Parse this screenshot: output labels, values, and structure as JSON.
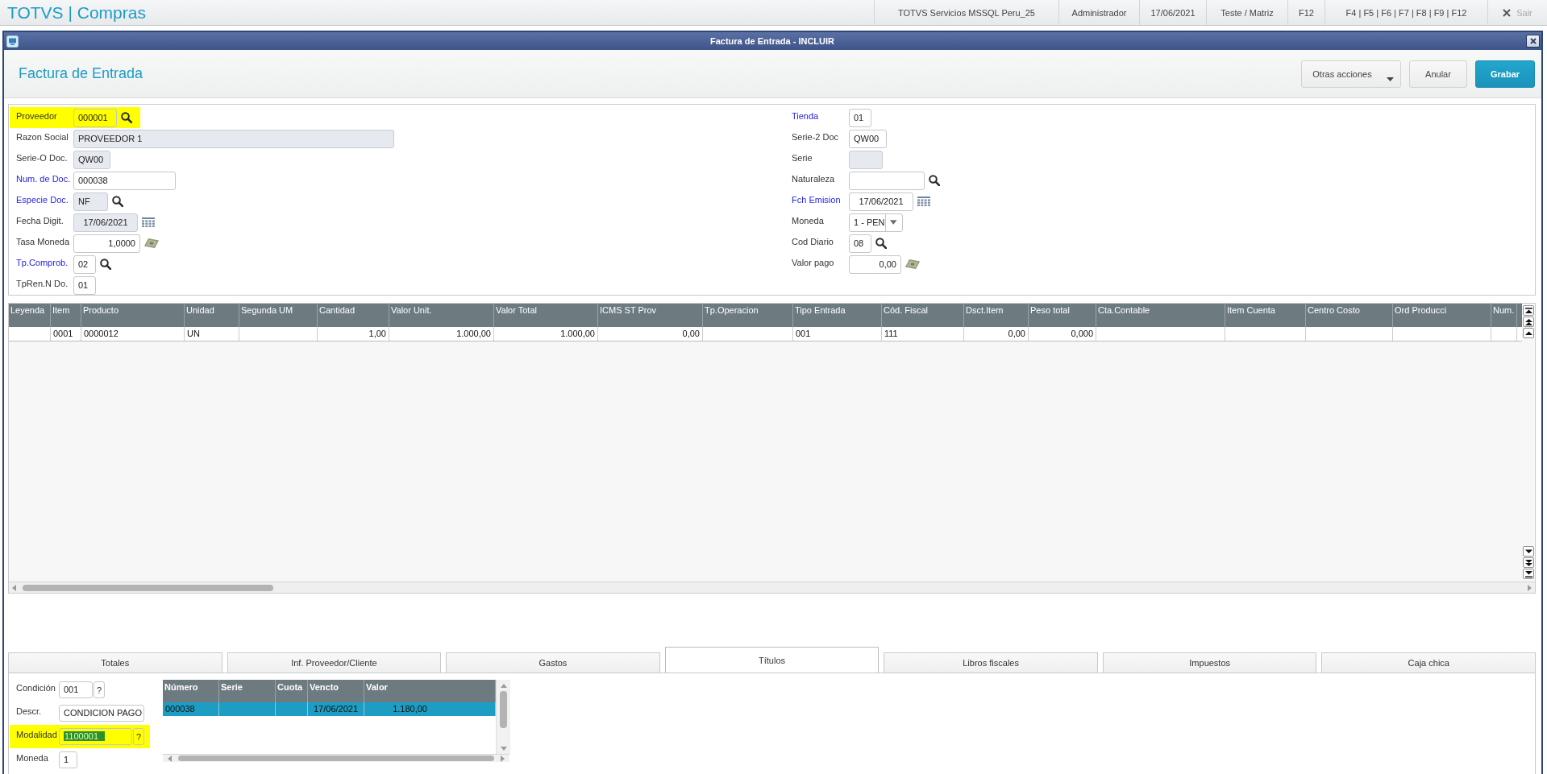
{
  "app_bar": {
    "title": "TOTVS | Compras",
    "info": [
      "TOTVS Servicios MSSQL Peru_25",
      "Administrador",
      "17/06/2021",
      "Teste / Matriz",
      "F12",
      "F4 | F5 | F6 | F7 | F8 | F9 | F12"
    ],
    "exit": {
      "label": "Sair",
      "disabled": true
    }
  },
  "window": {
    "title": "Factura de Entrada - INCLUIR"
  },
  "header": {
    "title": "Factura de Entrada",
    "actions": [
      {
        "label": "Otras acciones",
        "kind": "menu"
      },
      {
        "label": "Anular",
        "kind": "secondary"
      },
      {
        "label": "Grabar",
        "kind": "primary"
      }
    ]
  },
  "form": {
    "columns": [
      [
        {
          "label": "Proveedor",
          "value": "000001",
          "kind": "text",
          "required": false,
          "readonly": false,
          "highlighted": true,
          "addon": {
            "kind": "search"
          }
        },
        {
          "label": "Razon Social",
          "value": "PROVEEDOR 1",
          "kind": "text",
          "required": false,
          "readonly": true,
          "highlighted": false
        },
        {
          "label": "Serie-O Doc.",
          "value": "QW00",
          "kind": "text",
          "required": false,
          "readonly": true,
          "highlighted": false
        },
        {
          "label": "Num. de Doc.",
          "value": "000038",
          "kind": "text",
          "required": true,
          "readonly": false,
          "highlighted": false
        },
        {
          "label": "Especie Doc.",
          "value": "NF",
          "kind": "text",
          "required": true,
          "readonly": true,
          "highlighted": false,
          "addon": {
            "kind": "search"
          }
        },
        {
          "label": "Fecha Digit.",
          "value": "17/06/2021",
          "kind": "date",
          "required": false,
          "readonly": true,
          "highlighted": false,
          "addon": {
            "kind": "calendar"
          }
        },
        {
          "label": "Tasa Moneda",
          "value": "1,0000",
          "kind": "number",
          "required": false,
          "readonly": false,
          "highlighted": false,
          "addon": {
            "kind": "money"
          }
        },
        {
          "label": "Tp.Comprob.",
          "value": "02",
          "kind": "text",
          "required": true,
          "readonly": false,
          "highlighted": false,
          "addon": {
            "kind": "search"
          }
        },
        {
          "label": "TpRen.N Do.",
          "value": "01",
          "kind": "text",
          "required": false,
          "readonly": false,
          "highlighted": false
        }
      ],
      [
        {
          "label": "Tienda",
          "value": "01",
          "kind": "text",
          "required": true,
          "readonly": false,
          "highlighted": false
        },
        {
          "label": "Serie-2 Doc",
          "value": "QW00",
          "kind": "text",
          "required": false,
          "readonly": false,
          "highlighted": false
        },
        {
          "label": "Serie",
          "kind": "text",
          "required": false,
          "readonly": true,
          "highlighted": false
        },
        {
          "label": "Naturaleza",
          "kind": "text",
          "required": false,
          "readonly": false,
          "highlighted": false,
          "addon": {
            "kind": "search"
          }
        },
        {
          "label": "Fch Emision",
          "value": "17/06/2021",
          "kind": "date",
          "required": true,
          "readonly": false,
          "highlighted": false,
          "addon": {
            "kind": "calendar"
          }
        },
        {
          "label": "Moneda",
          "value": "1 - PEN",
          "kind": "select",
          "required": false,
          "readonly": false,
          "highlighted": false
        },
        {
          "label": "Cod Diario",
          "value": "08",
          "kind": "text",
          "required": false,
          "readonly": false,
          "highlighted": false,
          "addon": {
            "kind": "search"
          }
        },
        {
          "label": "Valor pago",
          "value": "0,00",
          "kind": "number",
          "required": false,
          "readonly": false,
          "highlighted": false,
          "addon": {
            "kind": "money"
          }
        }
      ]
    ]
  },
  "items_grid": {
    "columns": [
      {
        "label": "Leyenda",
        "kind": "text"
      },
      {
        "label": "Item",
        "kind": "text"
      },
      {
        "label": "Producto",
        "kind": "text"
      },
      {
        "label": "Unidad",
        "kind": "text"
      },
      {
        "label": "Segunda UM",
        "kind": "text"
      },
      {
        "label": "Cantidad",
        "kind": "number"
      },
      {
        "label": "Valor Unit.",
        "kind": "number"
      },
      {
        "label": "Valor Total",
        "kind": "number"
      },
      {
        "label": "ICMS ST Prov",
        "kind": "number"
      },
      {
        "label": "Tp.Operacion",
        "kind": "text"
      },
      {
        "label": "Tipo Entrada",
        "kind": "text"
      },
      {
        "label": "Cód. Fiscal",
        "kind": "text"
      },
      {
        "label": "Dsct.Item",
        "kind": "number"
      },
      {
        "label": "Peso total",
        "kind": "number"
      },
      {
        "label": "Cta.Contable",
        "kind": "text"
      },
      {
        "label": "Item Cuenta",
        "kind": "text"
      },
      {
        "label": "Centro Costo",
        "kind": "text"
      },
      {
        "label": "Ord Producci",
        "kind": "text"
      },
      {
        "label": "Num.",
        "kind": "text"
      }
    ],
    "rows": [
      {
        "cells": [
          null,
          "0001",
          "0000012",
          "UN",
          null,
          "1,00",
          "1.000,00",
          "1.000,00",
          "0,00",
          null,
          "001",
          "111",
          "0,00",
          "0,000",
          null,
          null,
          null,
          null,
          null
        ]
      }
    ]
  },
  "tabs": [
    {
      "label": "Totales",
      "selected": false
    },
    {
      "label": "Inf. Proveedor/Cliente",
      "selected": false
    },
    {
      "label": "Gastos",
      "selected": false
    },
    {
      "label": "Títulos",
      "selected": true
    },
    {
      "label": "Libros fiscales",
      "selected": false
    },
    {
      "label": "Impuestos",
      "selected": false
    },
    {
      "label": "Caja chica",
      "selected": false
    }
  ],
  "tab_panel": {
    "fields": [
      {
        "label": "Condición",
        "value": "001",
        "action": "?",
        "highlighted": false,
        "text_selected": false
      },
      {
        "label": "Descr.",
        "value": "CONDICION PAGO",
        "highlighted": false,
        "text_selected": false
      },
      {
        "label": "Modalidad",
        "value": "1100001",
        "action": "?",
        "highlighted": true,
        "text_selected": true
      },
      {
        "label": "Moneda",
        "value": "1",
        "highlighted": false,
        "text_selected": false
      }
    ],
    "grid": {
      "columns": [
        {
          "label": "Número",
          "kind": "text"
        },
        {
          "label": "Serie",
          "kind": "text"
        },
        {
          "label": "Cuota",
          "kind": "text"
        },
        {
          "label": "Vencto",
          "kind": "date"
        },
        {
          "label": "Valor",
          "kind": "number"
        }
      ],
      "rows": [
        {
          "cells": [
            "000038",
            null,
            null,
            "17/06/2021",
            "1.180,00"
          ],
          "selected": true
        }
      ]
    }
  }
}
